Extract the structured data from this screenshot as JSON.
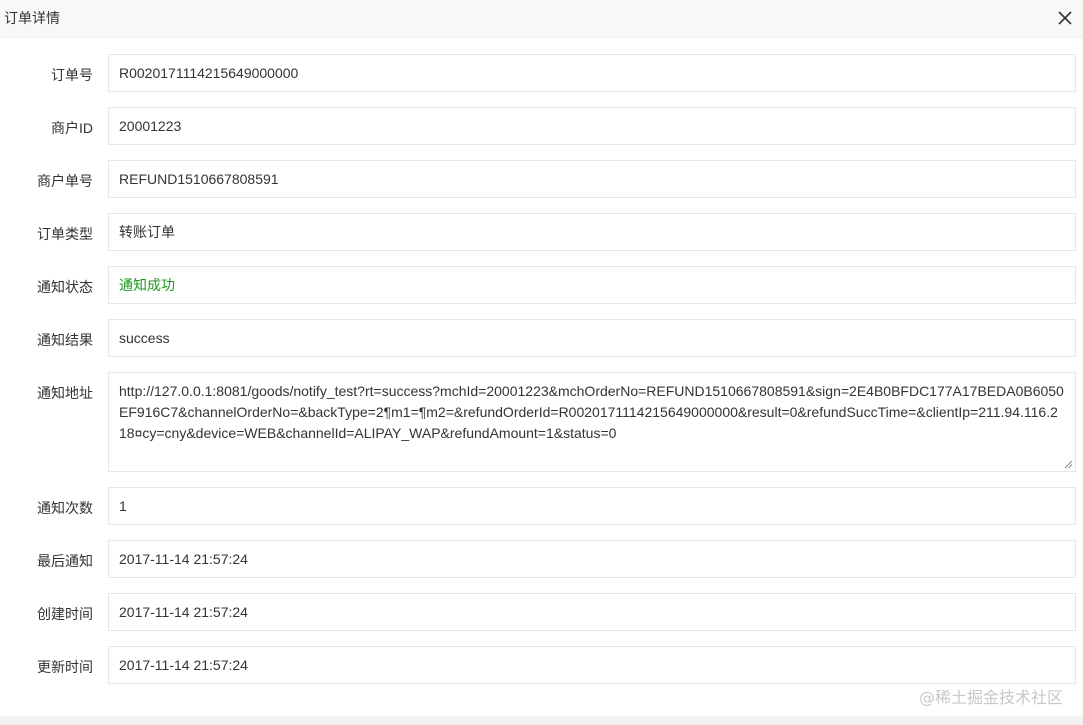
{
  "dialog": {
    "title": "订单详情",
    "close_icon": "close-icon"
  },
  "fields": [
    {
      "label": "订单号",
      "value": "R0020171114215649000000"
    },
    {
      "label": "商户ID",
      "value": "20001223"
    },
    {
      "label": "商户单号",
      "value": "REFUND1510667808591"
    },
    {
      "label": "订单类型",
      "value": "转账订单"
    },
    {
      "label": "通知状态",
      "value": "通知成功",
      "color": "#1e9a1e"
    },
    {
      "label": "通知结果",
      "value": "success"
    },
    {
      "label": "通知地址",
      "value": "http://127.0.0.1:8081/goods/notify_test?rt=success?mchId=20001223&mchOrderNo=REFUND1510667808591&sign=2E4B0BFDC177A17BEDA0B6050EF916C7&channelOrderNo=&backType=2¶m1=¶m2=&refundOrderId=R0020171114215649000000&result=0&refundSuccTime=&clientIp=211.94.116.218¤cy=cny&device=WEB&channelId=ALIPAY_WAP&refundAmount=1&status=0"
    },
    {
      "label": "通知次数",
      "value": "1"
    },
    {
      "label": "最后通知",
      "value": "2017-11-14 21:57:24"
    },
    {
      "label": "创建时间",
      "value": "2017-11-14 21:57:24"
    },
    {
      "label": "更新时间",
      "value": "2017-11-14 21:57:24"
    }
  ],
  "watermark": "@稀土掘金技术社区"
}
